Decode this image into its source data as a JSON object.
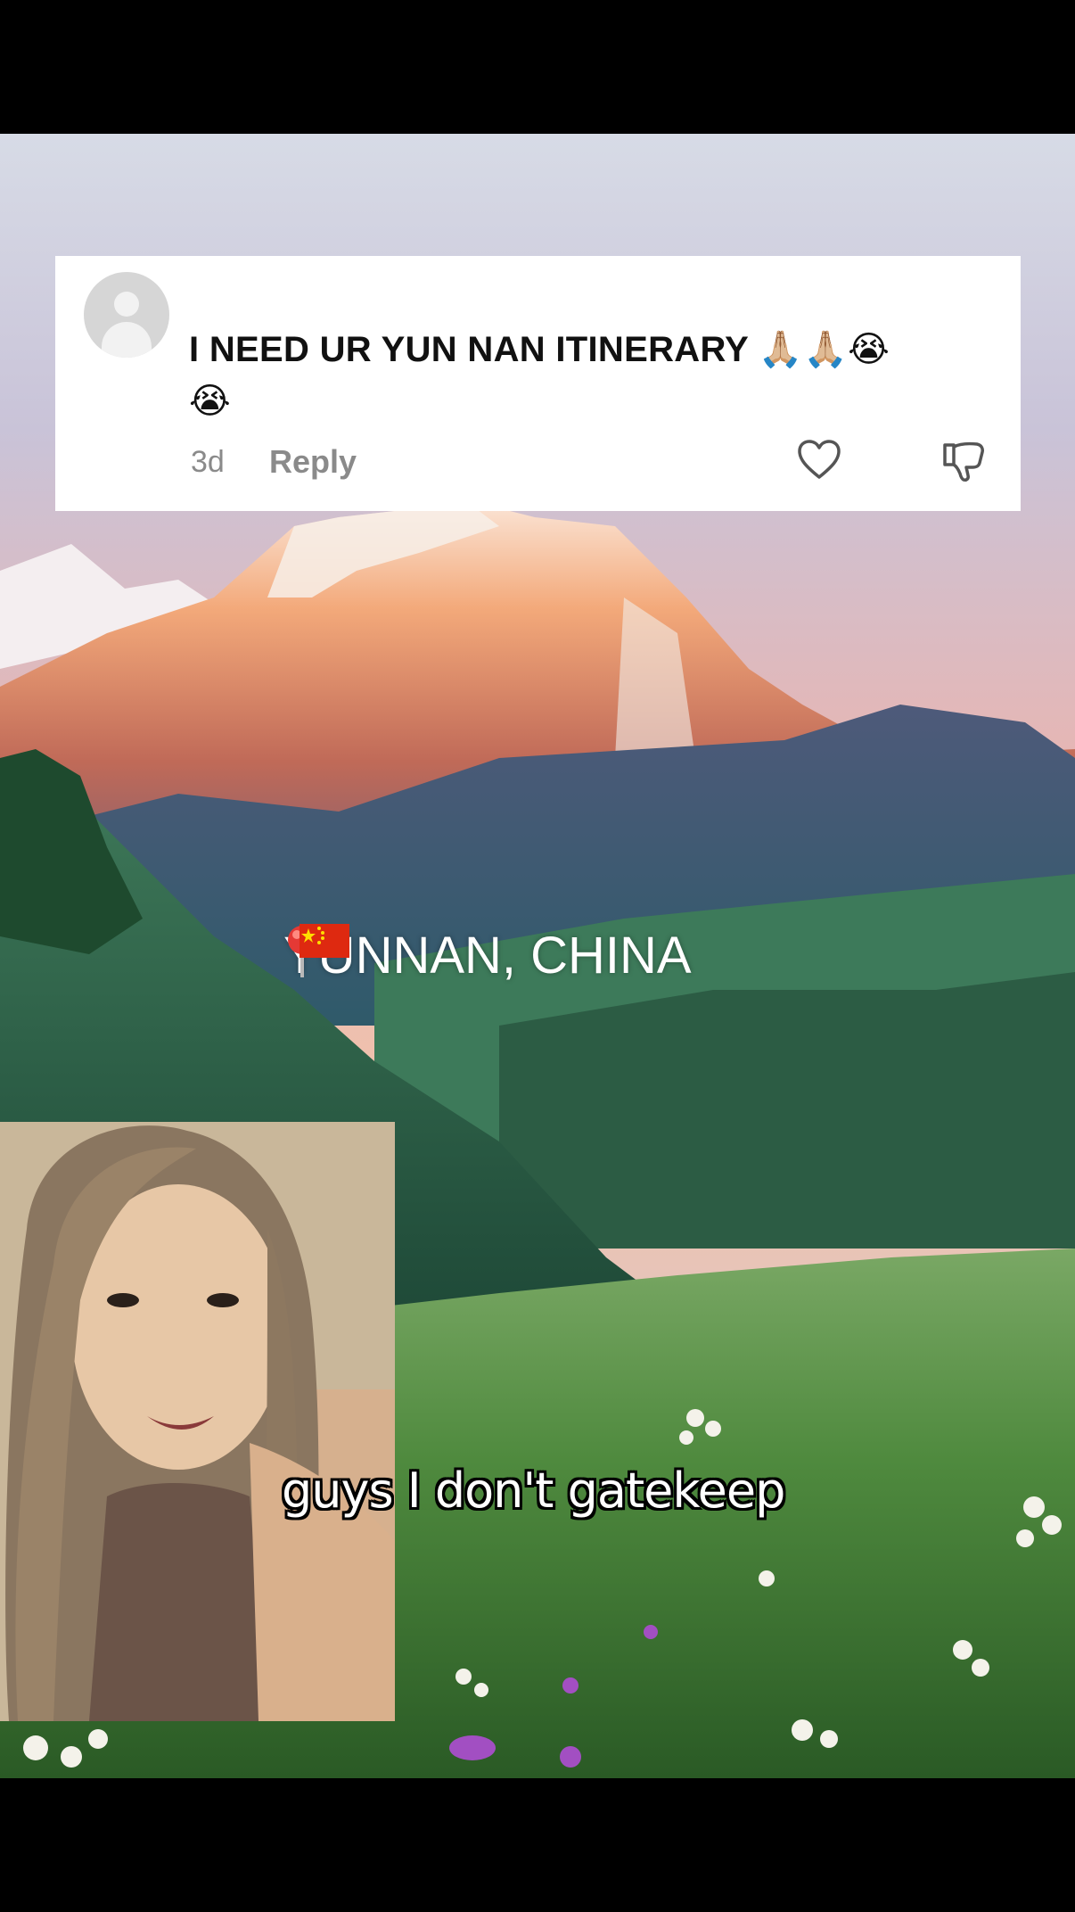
{
  "comment": {
    "text": "I NEED UR YUN NAN ITINERARY",
    "emojis": "🙏🏼🙏🏼😭",
    "emoji_line2": "😭",
    "time": "3d",
    "reply_label": "Reply",
    "avatar_icon": "default-user-avatar",
    "like_icon": "heart-outline-icon",
    "dislike_icon": "thumbs-down-outline-icon"
  },
  "overlay": {
    "location_text": "YUNNAN, CHINA",
    "location_icon": "round-pushpin-icon",
    "flag_icon": "china-flag-icon",
    "caption": "guys I don't gatekeep"
  },
  "colors": {
    "card_bg": "#ffffff",
    "meta_gray": "#8a8a8a",
    "frame_bg": "#000000"
  }
}
